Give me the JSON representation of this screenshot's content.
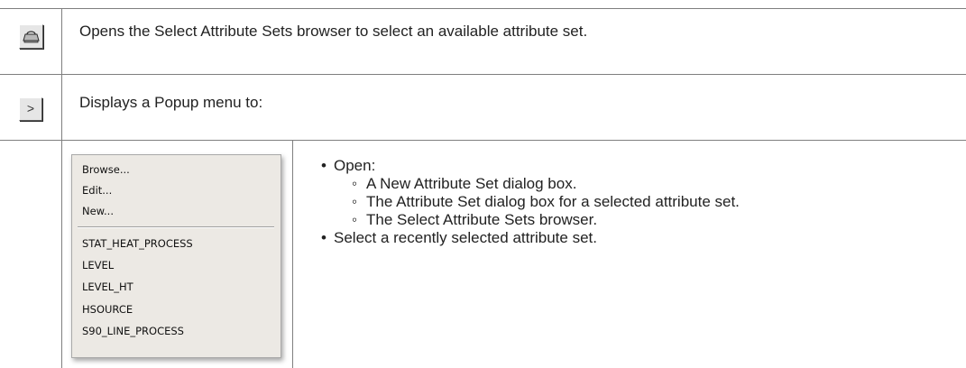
{
  "rows": [
    {
      "icon": "attribute-set-browser-icon",
      "description": "Opens the Select Attribute Sets browser to select an available attribute set."
    },
    {
      "icon": "popup-arrow-icon",
      "glyph": ">",
      "description": "Displays a Popup menu to:"
    }
  ],
  "popup_menu": {
    "actions": [
      "Browse...",
      "Edit...",
      "New..."
    ],
    "recent_sets": [
      "STAT_HEAT_PROCESS",
      "LEVEL",
      "LEVEL_HT",
      "HSOURCE",
      "S90_LINE_PROCESS"
    ]
  },
  "bullets": {
    "open_label": "Open:",
    "open_items": [
      "A New Attribute Set dialog box.",
      "The Attribute Set dialog box for a selected attribute set.",
      "The Select Attribute Sets browser."
    ],
    "select_label": "Select a recently selected attribute set."
  },
  "colors": {
    "border": "#7f7f7f",
    "button_face": "#e6e6e6",
    "menu_bg": "#ece9e4"
  }
}
